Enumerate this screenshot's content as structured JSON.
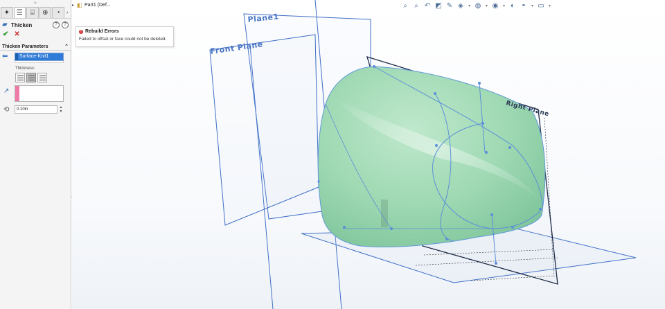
{
  "property_manager": {
    "grip": "»",
    "tabs": [
      {
        "name": "feature-manager-tab",
        "glyph": "✦"
      },
      {
        "name": "property-manager-tab",
        "glyph": "☰"
      },
      {
        "name": "configuration-manager-tab",
        "glyph": "⌸"
      },
      {
        "name": "dimxpert-manager-tab",
        "glyph": "⊕"
      },
      {
        "name": "display-manager-tab",
        "glyph": "◔"
      }
    ],
    "more_tabs": "›",
    "feature_title": "Thicken",
    "ok_glyph": "✔",
    "cancel_glyph": "✕",
    "section_title": "Thicken Parameters",
    "section_toggle": "⌃",
    "surface_selection": "Surface-Knit1",
    "thickness_label": "Thickness:",
    "thickness_value": "0.10in",
    "spin_up": "▲",
    "spin_down": "▼",
    "collapse_glyph": "‹"
  },
  "tree": {
    "expand": "▸",
    "part_label": "Part1  (Def..."
  },
  "tooltip": {
    "title": "Rebuild Errors",
    "message": "Failed to offset or face could not be deleted."
  },
  "planes": {
    "plane1": "Plane1",
    "front": "Front Plane",
    "right": "Right Plane"
  },
  "heads_up_icons": [
    "zoom-to-fit-icon",
    "zoom-to-area-icon",
    "previous-view-icon",
    "section-view-icon",
    "dynamic-annotation-icon",
    "view-orientation-icon",
    "display-style-icon",
    "hide-show-items-icon",
    "edit-appearance-icon",
    "apply-scene-icon",
    "view-settings-icon"
  ],
  "colors": {
    "surface_fill": "#9fd9b3",
    "plane_stroke": "#3f6fc7",
    "accent_selection": "#2f7bd8",
    "error_red": "#d32f2f"
  }
}
